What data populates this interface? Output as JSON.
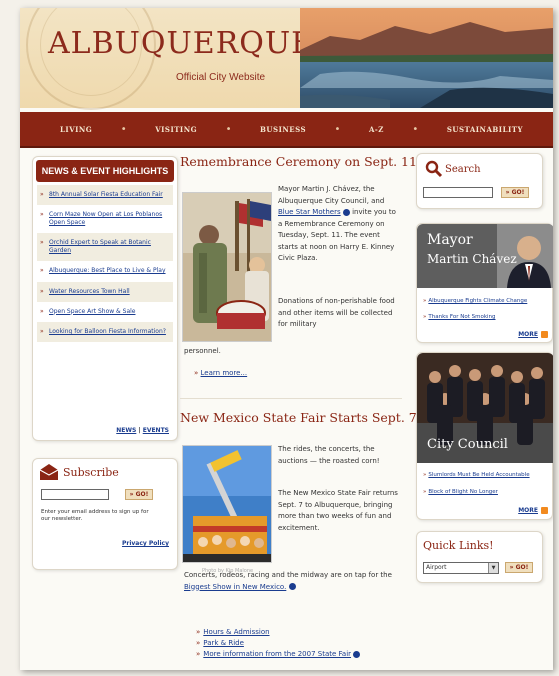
{
  "header": {
    "title": "ALBUQUERQUE",
    "tagline": "Official City Website"
  },
  "nav": {
    "items": [
      "LIVING",
      "VISITING",
      "BUSINESS",
      "A-Z",
      "SUSTAINABILITY"
    ],
    "separator": "•"
  },
  "news": {
    "heading": "NEWS & EVENT HIGHLIGHTS",
    "bullet": "»",
    "items": [
      "8th Annual Solar Fiesta Education Fair",
      "Corn Maze Now Open at Los Poblanos Open Space",
      "Orchid Expert to Speak at Botanic Garden",
      "Albuquerque: Best Place to Live & Play",
      "Water Resources Town Hall",
      "Open Space Art Show & Sale",
      "Looking for Balloon Fiesta Information?"
    ],
    "news_link": "NEWS",
    "link_sep": "|",
    "events_link": "EVENTS"
  },
  "subscribe": {
    "title": "Subscribe",
    "go_label": "» GO!",
    "help_text": "Enter your email address to sign up for our newsletter.",
    "privacy_label": "Privacy Policy"
  },
  "article1": {
    "title": "Remembrance Ceremony on Sept. 11",
    "p1_before": "Mayor Martin J. Chávez, the Albuquerque City Council, and ",
    "p1_link": "Blue Star Mothers",
    "p1_after": " invite you to a Remembrance Ceremony on Tuesday, Sept. 11. The event starts at noon on Harry E. Kinney Civic Plaza.",
    "p2": "Donations of non-perishable food and other items will be collected for military",
    "p2_cont": "personnel.",
    "more_label": "Learn more...",
    "bullet": "»"
  },
  "article2": {
    "title": "New Mexico State Fair Starts Sept. 7",
    "p1": "The rides, the concerts, the auctions — the roasted corn!",
    "p2": "The New Mexico State Fair returns Sept. 7 to Albuquerque, bringing more than two weeks of fun and excitement.",
    "photo_credit": "Photo by Kip Malone",
    "p3_before": "Concerts, rodeos, racing and the midway are on tap for the ",
    "p3_link": "Biggest Show in New Mexico.",
    "links": [
      "Hours & Admission",
      "Park & Ride",
      "More information from the 2007 State Fair"
    ],
    "bullet": "»"
  },
  "search": {
    "title": "Search",
    "go_label": "» GO!"
  },
  "mayor": {
    "title": "Mayor",
    "name": "Martin Chávez",
    "links": [
      "Albuquerque Fights Climate Change",
      "Thanks For Not Smoking"
    ],
    "more_label": "MORE",
    "bullet": "»"
  },
  "council": {
    "title": "City Council",
    "links": [
      "Slumlords Must Be Held Accountable",
      "Block of Blight No Longer"
    ],
    "more_label": "MORE",
    "bullet": "»"
  },
  "quick_links": {
    "title": "Quick Links!",
    "selected": "Airport",
    "arrow": "▼",
    "go_label": "» GO!"
  },
  "colors": {
    "brand": "#8a2514",
    "link": "#1a3c8f",
    "header_bg": "#efd9ad"
  }
}
